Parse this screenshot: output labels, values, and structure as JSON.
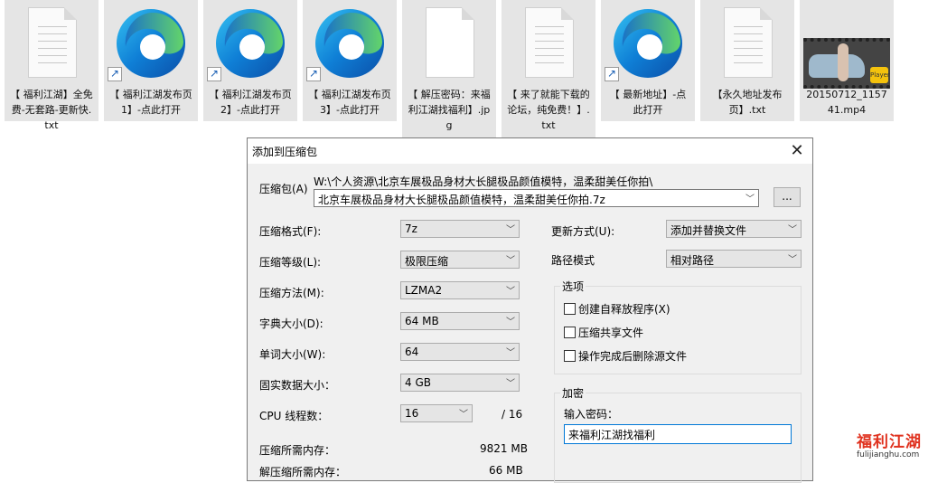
{
  "desktop": {
    "files": [
      {
        "label": "【 福利江湖】全免费-无套路-更新快.txt",
        "type": "txt",
        "shortcut": false
      },
      {
        "label": "【 福利江湖发布页1】-点此打开",
        "type": "edge-link",
        "shortcut": true
      },
      {
        "label": "【 福利江湖发布页2】-点此打开",
        "type": "edge-link",
        "shortcut": true
      },
      {
        "label": "【 福利江湖发布页3】-点此打开",
        "type": "edge-link",
        "shortcut": true
      },
      {
        "label": "【 解压密码：来福利江湖找福利】.jpg",
        "type": "jpg",
        "shortcut": false
      },
      {
        "label": "【 来了就能下载的论坛，纯免费！】.txt",
        "type": "txt",
        "shortcut": false
      },
      {
        "label": "【 最新地址】-点此打开",
        "type": "edge-link",
        "shortcut": true
      },
      {
        "label": "【永久地址发布页】.txt",
        "type": "txt",
        "shortcut": false
      },
      {
        "label": "20150712_115741.mp4",
        "type": "video",
        "shortcut": false
      }
    ],
    "video_badge": "Player"
  },
  "dialog": {
    "title": "添加到压缩包",
    "archive_label": "压缩包(A)",
    "archive_path": "W:\\个人资源\\北京车展极品身材大长腿极品颜值模特，温柔甜美任你拍\\",
    "archive_name": "北京车展极品身材大长腿极品颜值模特，温柔甜美任你拍.7z",
    "browse_label": "...",
    "left_fields": [
      {
        "label": "压缩格式(F):",
        "value": "7z"
      },
      {
        "label": "压缩等级(L):",
        "value": "极限压缩"
      },
      {
        "label": "压缩方法(M):",
        "value": "LZMA2"
      },
      {
        "label": "字典大小(D):",
        "value": "64 MB"
      },
      {
        "label": "单词大小(W):",
        "value": "64"
      },
      {
        "label": "固实数据大小：",
        "value": "4 GB"
      }
    ],
    "cpu_label": "CPU 线程数：",
    "cpu_value": "16",
    "cpu_total": "/ 16",
    "memory_label": "压缩所需内存：",
    "memory_value": "9821 MB",
    "decompress_memory_label": "解压缩所需内存：",
    "decompress_memory_value": "66 MB",
    "update_label": "更新方式(U):",
    "update_value": "添加并替换文件",
    "path_label": "路径模式",
    "path_value": "相对路径",
    "options_title": "选项",
    "options": [
      {
        "label": "创建自释放程序(X)",
        "checked": false
      },
      {
        "label": "压缩共享文件",
        "checked": false
      },
      {
        "label": "操作完成后删除源文件",
        "checked": false
      }
    ],
    "encrypt_title": "加密",
    "password_label": "输入密码：",
    "password_value": "来福利江湖找福利"
  },
  "watermark": {
    "text_cn": "福利江湖",
    "text_en": "fulijianghu.com"
  }
}
